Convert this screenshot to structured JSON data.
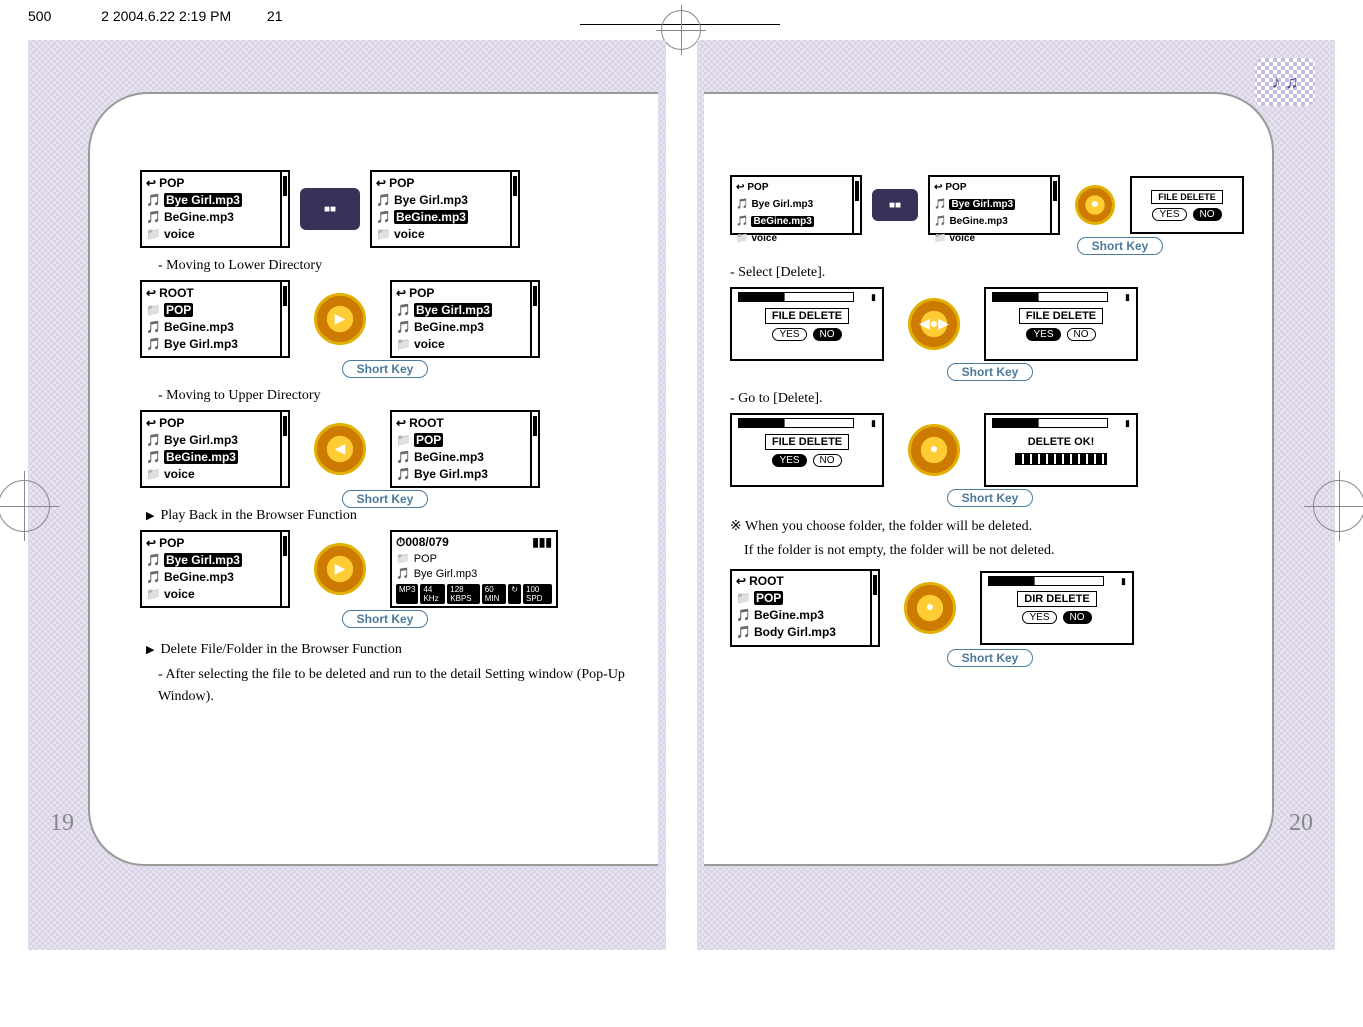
{
  "header_line": "500 　　　 2  2004.6.22 2:19 PM 　　 21",
  "page_left": "19",
  "page_right": "20",
  "short_key_label": "Short Key",
  "left": {
    "caption_lower": "- Moving to Lower Directory",
    "caption_upper": "- Moving to Upper Directory",
    "heading_play": "Play Back in the Browser Function",
    "heading_delete": "Delete File/Folder in the Browser Function",
    "after_select": "- After selecting the file to be deleted and run to the detail Setting window (Pop-Up Window).",
    "lcd_pop1": {
      "title": "POP",
      "items": [
        "Bye Girl.mp3",
        "BeGine.mp3",
        "voice"
      ],
      "sel": 0,
      "icons": [
        "file",
        "file",
        "fold"
      ]
    },
    "lcd_pop2": {
      "title": "POP",
      "items": [
        "Bye Girl.mp3",
        "BeGine.mp3",
        "voice"
      ],
      "sel": 1,
      "icons": [
        "file",
        "file",
        "fold"
      ]
    },
    "lcd_root": {
      "title": "ROOT",
      "items": [
        "POP",
        "BeGine.mp3",
        "Bye Girl.mp3"
      ],
      "sel": 0,
      "icons": [
        "fold",
        "file",
        "file"
      ]
    },
    "lcd_pop3": {
      "title": "POP",
      "items": [
        "Bye Girl.mp3",
        "BeGine.mp3",
        "voice"
      ],
      "sel": 0,
      "icons": [
        "file",
        "file",
        "fold"
      ]
    },
    "lcd_pop4": {
      "title": "POP",
      "items": [
        "Bye Girl.mp3",
        "BeGine.mp3",
        "voice"
      ],
      "sel": 1,
      "icons": [
        "file",
        "file",
        "fold"
      ]
    },
    "lcd_root2": {
      "title": "ROOT",
      "items": [
        "POP",
        "BeGine.mp3",
        "Bye Girl.mp3"
      ],
      "sel": 0,
      "icons": [
        "fold",
        "file",
        "file"
      ]
    },
    "lcd_pop5": {
      "title": "POP",
      "items": [
        "Bye Girl.mp3",
        "BeGine.mp3",
        "voice"
      ],
      "sel": 0,
      "icons": [
        "file",
        "file",
        "fold"
      ]
    },
    "progress": {
      "count": "008/079",
      "folder": "POP",
      "file": "Bye Girl.mp3",
      "tags": [
        "MP3",
        "44 KHz",
        "128 KBPS",
        "60 MIN",
        "↻",
        "100 SPD"
      ]
    }
  },
  "right": {
    "lcd_topA": {
      "title": "POP",
      "items": [
        "Bye Girl.mp3",
        "BeGine.mp3",
        "voice"
      ],
      "sel": 1,
      "icons": [
        "file",
        "file",
        "fold"
      ]
    },
    "lcd_topB": {
      "title": "POP",
      "items": [
        "Bye Girl.mp3",
        "BeGine.mp3",
        "voice"
      ],
      "sel": 0,
      "icons": [
        "file",
        "file",
        "fold"
      ]
    },
    "popup_top": {
      "title": "FILE DELETE",
      "yes": "YES",
      "no": "NO",
      "yes_on": false
    },
    "caption_select": "- Select [Delete].",
    "popup_left": {
      "title": "FILE DELETE",
      "yes": "YES",
      "no": "NO",
      "yes_on": false
    },
    "popup_right": {
      "title": "FILE DELETE",
      "yes": "YES",
      "no": "NO",
      "yes_on": true
    },
    "caption_goto": "- Go to [Delete].",
    "popup_goto_left": {
      "title": "FILE DELETE",
      "yes": "YES",
      "no": "NO",
      "yes_on": true
    },
    "popup_ok": {
      "title": "DELETE OK!",
      "bar": true
    },
    "note1": "When you choose folder, the folder will be deleted.",
    "note2": "If the folder is not empty, the folder will be not deleted.",
    "lcd_root3": {
      "title": "ROOT",
      "items": [
        "POP",
        "BeGine.mp3",
        "Body Girl.mp3"
      ],
      "sel": 0,
      "icons": [
        "fold",
        "file",
        "file"
      ]
    },
    "popup_dir": {
      "title": "DIR DELETE",
      "yes": "YES",
      "no": "NO",
      "yes_on": false
    }
  },
  "corner_glyphs": "♪ ♫"
}
